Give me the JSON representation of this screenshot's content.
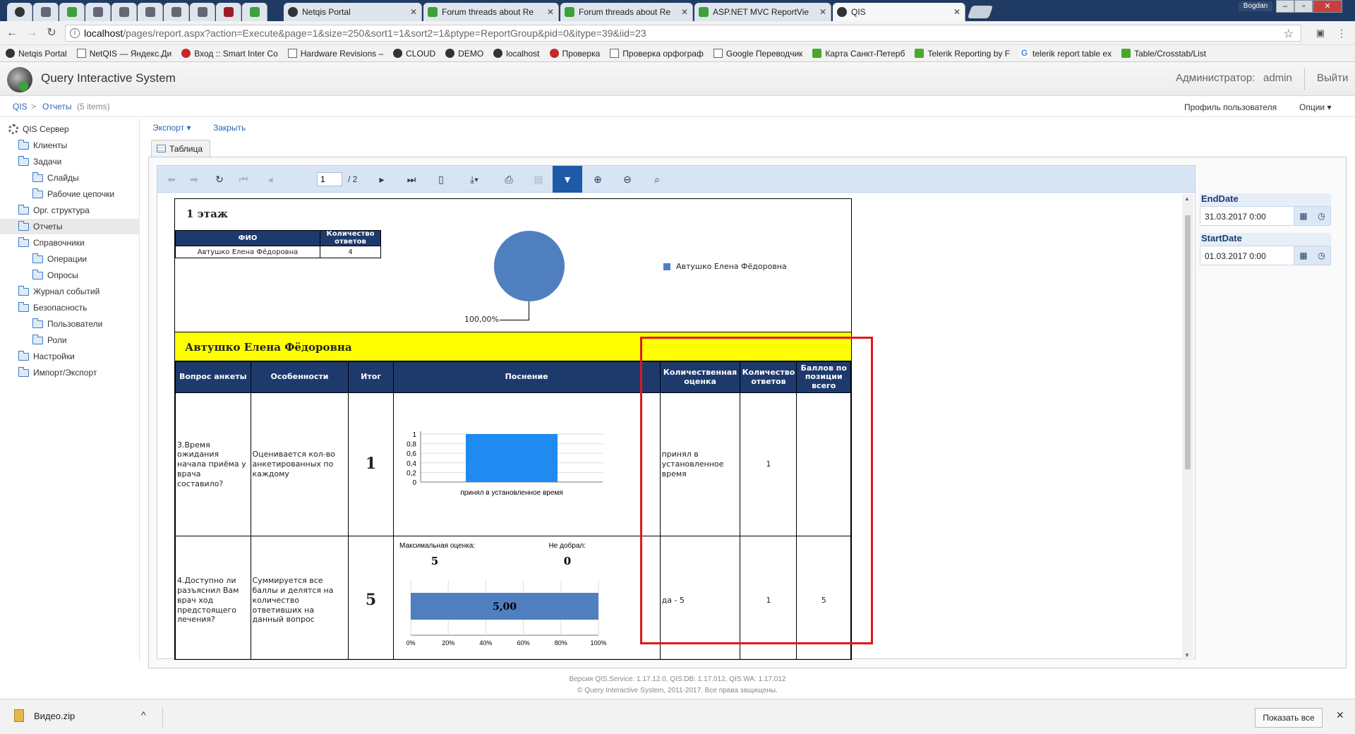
{
  "browser": {
    "tabs": [
      {
        "title": "",
        "icon": "app-icon"
      },
      {
        "title": "",
        "icon": "app-icon"
      },
      {
        "title": "",
        "icon": "drive-icon"
      },
      {
        "title": "",
        "icon": "tool-icon"
      },
      {
        "title": "",
        "icon": "app-icon"
      },
      {
        "title": "",
        "icon": "app-icon"
      },
      {
        "title": "",
        "icon": "app-icon"
      },
      {
        "title": "",
        "icon": "app-icon"
      },
      {
        "title": "",
        "icon": "app-icon"
      },
      {
        "title": "",
        "icon": "telerik-icon"
      },
      {
        "title": "Netqis Portal",
        "icon": "qis-icon"
      },
      {
        "title": "Forum threads about Re",
        "icon": "telerik-icon"
      },
      {
        "title": "Forum threads about Re",
        "icon": "telerik-icon"
      },
      {
        "title": "ASP.NET MVC ReportVie",
        "icon": "telerik-icon"
      },
      {
        "title": "QIS",
        "icon": "qis-icon"
      }
    ],
    "user_badge": "Bogdan",
    "url_host": "localhost",
    "url_path": "/pages/report.aspx?action=Execute&page=1&size=250&sort1=1&sort2=1&ptype=ReportGroup&pid=0&itype=39&iid=23",
    "bookmarks": [
      "Netqis Portal",
      "NetQIS — Яндекс.Ди",
      "Вход :: Smart Inter Co",
      "Hardware Revisions –",
      "CLOUD",
      "DEMO",
      "localhost",
      "Проверка",
      "Проверка орфограф",
      "Google Переводчик",
      "Карта Санкт-Петерб",
      "Telerik Reporting by F",
      "telerik report table ex",
      "Table/Crosstab/List"
    ]
  },
  "app": {
    "title": "Query Interactive System",
    "admin_label": "Администратор:",
    "admin_name": "admin",
    "logout": "Выйти",
    "breadcrumb_root": "QIS",
    "breadcrumb_sep": ">",
    "breadcrumb_current": "Отчеты",
    "breadcrumb_count": "(5 items)",
    "profile": "Профиль пользователя",
    "options": "Опции"
  },
  "sidebar": {
    "items": [
      {
        "label": "QIS Сервер"
      },
      {
        "label": "Клиенты"
      },
      {
        "label": "Задачи"
      },
      {
        "label": "Слайды"
      },
      {
        "label": "Рабочие цепочки"
      },
      {
        "label": "Орг. структура"
      },
      {
        "label": "Отчеты"
      },
      {
        "label": "Справочники"
      },
      {
        "label": "Операции"
      },
      {
        "label": "Опросы"
      },
      {
        "label": "Журнал событий"
      },
      {
        "label": "Безопасность"
      },
      {
        "label": "Пользователи"
      },
      {
        "label": "Роли"
      },
      {
        "label": "Настройки"
      },
      {
        "label": "Импорт/Экспорт"
      }
    ]
  },
  "main": {
    "export": "Экспорт",
    "close": "Закрыть",
    "tab_table": "Таблица",
    "page_current": "1",
    "page_total": "/ 2"
  },
  "report": {
    "floor_title": "1 этаж",
    "mini_headers": [
      "ФИО",
      "Количество ответов"
    ],
    "mini_row": [
      "Автушко Елена Фёдоровна",
      "4"
    ],
    "pie_label": "100,00%",
    "legend_name": "Автушко Елена Фёдоровна",
    "person_header": "Автушко Елена Фёдоровна",
    "grid_headers": [
      "Вопрос анкеты",
      "Особенности",
      "Итог",
      "Поснение",
      "Количественная оценка",
      "Количество ответов",
      "Баллов по позиции всего"
    ],
    "rows": [
      {
        "question": "3.Время ожидания начала приёма у врача составило?",
        "feature": "Оценивается кол-во анкетированных по каждому",
        "total": "1",
        "quant": "принял в установленное время",
        "answers": "1",
        "points": ""
      },
      {
        "question": "4.Доступно ли разъяснил Вам врач ход предстоящего лечения?",
        "feature": "Суммируется все баллы и делятся на количество ответивших на данный вопрос",
        "total": "5",
        "quant": "да - 5",
        "answers": "1",
        "points": "5",
        "max_label": "Максимальная оценка:",
        "max_value": "5",
        "miss_label": "Не добрал:",
        "miss_value": "0",
        "bar_value_label": "5,00"
      }
    ]
  },
  "params": {
    "end_label": "EndDate",
    "end_value": "31.03.2017 0:00",
    "start_label": "StartDate",
    "start_value": "01.03.2017 0:00"
  },
  "footer": {
    "version": "Версия  QIS.Service: 1.17.12.0,  QIS.DB: 1.17.012,  QIS.WA: 1.17.012",
    "copyright": "© Query Interactive System, 2011-2017.  Все права защищены."
  },
  "downloads": {
    "file": "Видео.zip",
    "show_all": "Показать все"
  },
  "chart_data": [
    {
      "type": "pie",
      "categories": [
        "Автушко Елена Фёдоровна"
      ],
      "values": [
        100
      ],
      "data_labels": [
        "100,00%"
      ]
    },
    {
      "type": "bar",
      "categories": [
        "принял в установленное время"
      ],
      "values": [
        1
      ],
      "ylim": [
        0,
        1
      ],
      "yticks": [
        "0",
        "0,2",
        "0,4",
        "0,6",
        "0,8",
        "1"
      ]
    },
    {
      "type": "bar",
      "orientation": "horizontal",
      "values": [
        5
      ],
      "data_labels": [
        "5,00"
      ],
      "xticks": [
        "0%",
        "20%",
        "40%",
        "60%",
        "80%",
        "100%"
      ]
    }
  ]
}
